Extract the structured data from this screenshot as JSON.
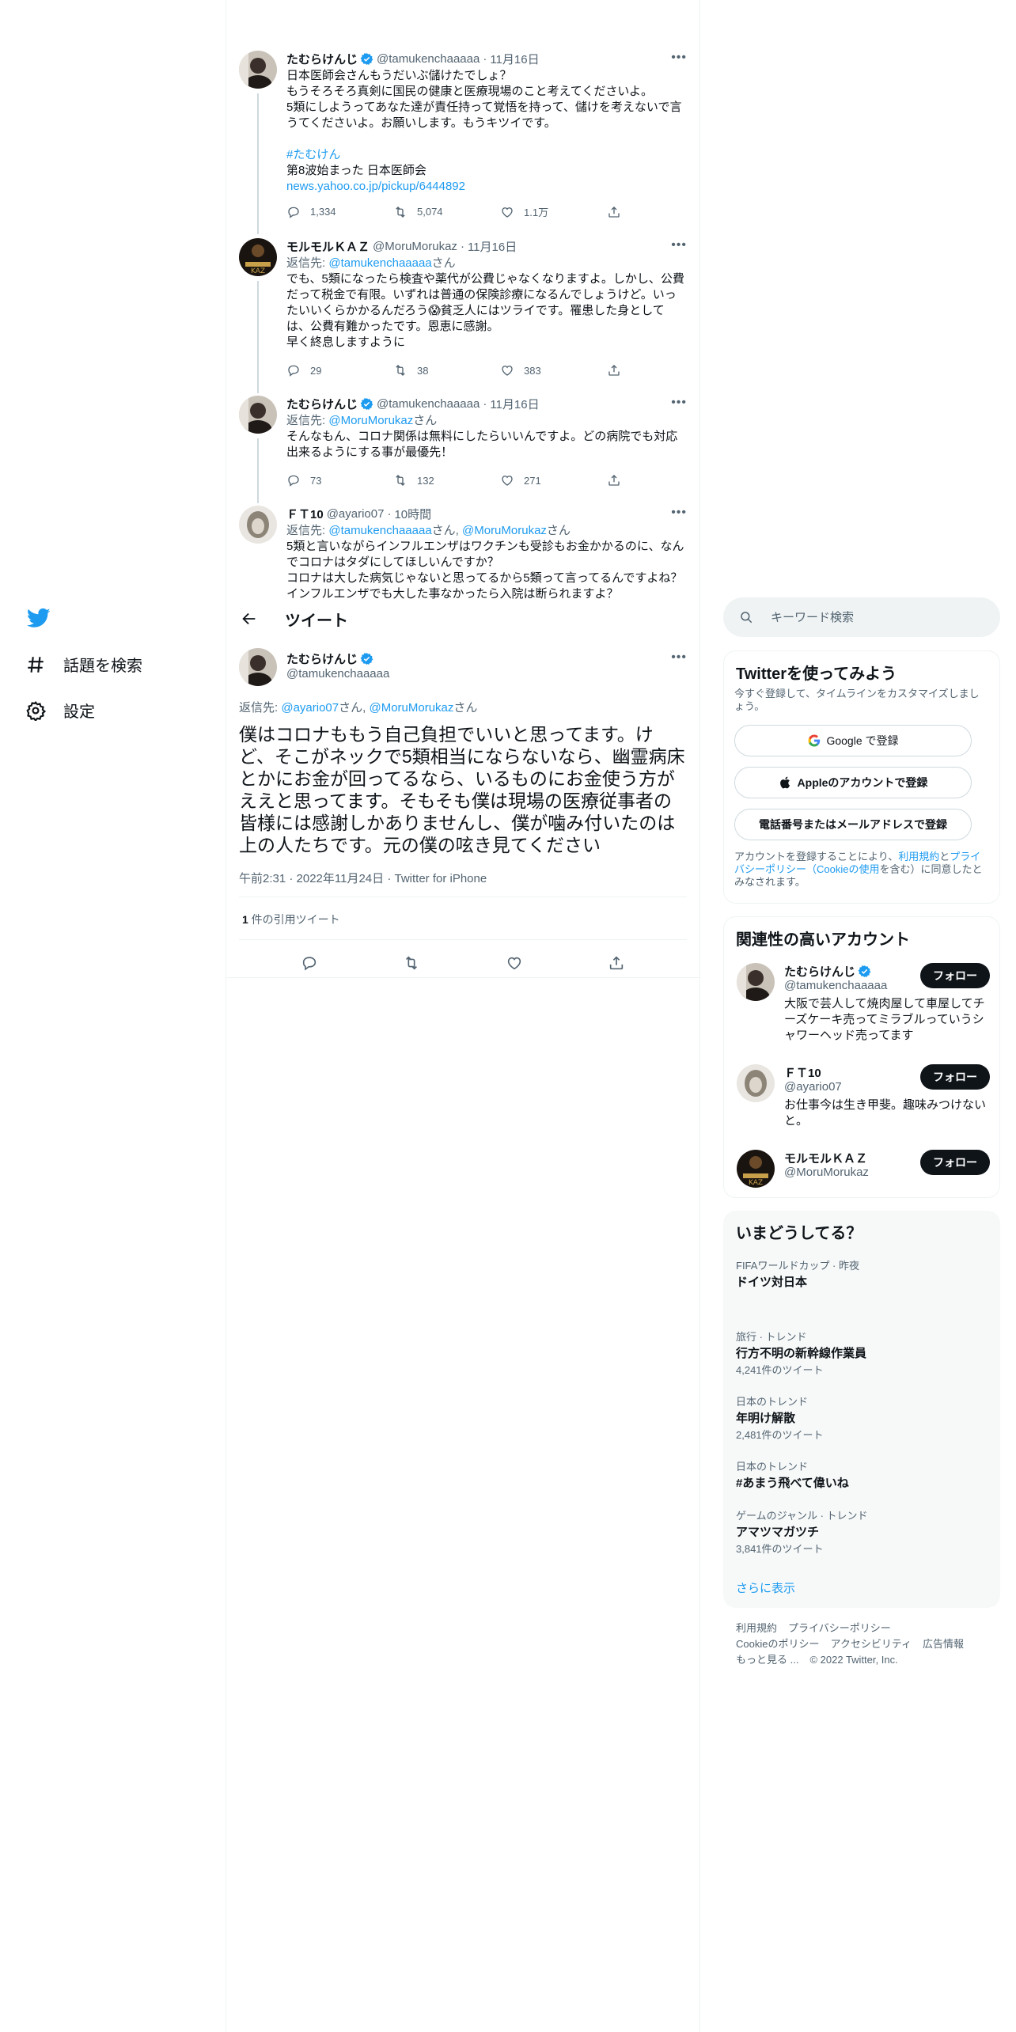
{
  "nav": {
    "items": [
      {
        "label": "話題を検索",
        "icon": "hashtag-icon"
      },
      {
        "label": "設定",
        "icon": "gear-icon"
      }
    ]
  },
  "thread": [
    {
      "name": "たむらけんじ",
      "verified": true,
      "handle": "@tamukenchaaaaa",
      "date": "11月16日",
      "lines": [
        "日本医師会さんもうだいぶ儲けたでしょ？",
        "もうそろそろ真剣に国民の健康と医療現場のこと考えてくださいよ。",
        "5類にしようってあなた達が責任持って覚悟を持って、儲けを考えないで言うてくださいよ。お願いします。もうキツイです。"
      ],
      "hashtag": "#たむけん",
      "card_title": "第8波始まった 日本医師会",
      "link": "news.yahoo.co.jp/pickup/6444892",
      "replies": "1,334",
      "retweets": "5,074",
      "likes": "1.1万"
    },
    {
      "name": "モルモルＫＡＺ",
      "handle": "@MoruMorukaz",
      "date": "11月16日",
      "reply_prefix": "返信先: ",
      "reply_to": "@tamukenchaaaaa",
      "reply_suffix": "さん",
      "lines": [
        "でも、5類になったら検査や薬代が公費じゃなくなりますよ。しかし、公費だって税金で有限。いずれは普通の保険診療になるんでしょうけど。いったいいくらかかるんだろう😱貧乏人にはツライです。罹患した身としては、公費有難かったです。恩恵に感謝。",
        "早く終息しますように"
      ],
      "replies": "29",
      "retweets": "38",
      "likes": "383"
    },
    {
      "name": "たむらけんじ",
      "verified": true,
      "handle": "@tamukenchaaaaa",
      "date": "11月16日",
      "reply_prefix": "返信先: ",
      "reply_to": "@MoruMorukaz",
      "reply_suffix": "さん",
      "lines": [
        "そんなもん、コロナ関係は無料にしたらいいんですよ。どの病院でも対応出来るようにする事が最優先！"
      ],
      "replies": "73",
      "retweets": "132",
      "likes": "271"
    },
    {
      "name": "ＦＴ10",
      "handle": "@ayario07",
      "date": "10時間",
      "reply_prefix": "返信先: ",
      "reply_to": "@tamukenchaaaaa",
      "reply_mid": "さん, ",
      "reply_to2": "@MoruMorukaz",
      "reply_suffix": "さん",
      "lines": [
        "5類と言いながらインフルエンザはワクチンも受診もお金かかるのに、なんでコロナはタダにしてほしいんですか？",
        "コロナは大した病気じゃないと思ってるから5類って言ってるんですよね？",
        "インフルエンザでも大した事なかったら入院は断られますよ？"
      ]
    }
  ],
  "detail": {
    "header_title": "ツイート",
    "name": "たむらけんじ",
    "verified": true,
    "handle": "@tamukenchaaaaa",
    "reply_prefix": "返信先: ",
    "reply_to": "@ayario07",
    "reply_mid": "さん, ",
    "reply_to2": "@MoruMorukaz",
    "reply_suffix": "さん",
    "text": "僕はコロナももう自己負担でいいと思ってます。けど、そこがネックで5類相当にならないなら、幽霊病床とかにお金が回ってるなら、いるものにお金使う方がええと思ってます。そもそも僕は現場の医療従事者の皆様には感謝しかありませんし、僕が噛み付いたのは上の人たちです。元の僕の呟き見てください",
    "meta": "午前2:31 · 2022年11月24日 · Twitter for iPhone",
    "quote_count": "1",
    "quote_label": " 件の引用ツイート"
  },
  "search": {
    "placeholder": "キーワード検索"
  },
  "signup": {
    "title": "Twitterを使ってみよう",
    "subtitle": "今すぐ登録して、タイムラインをカスタマイズしましょう。",
    "google": "Google で登録",
    "apple": "Appleのアカウントで登録",
    "phone": "電話番号またはメールアドレスで登録",
    "terms_prefix": "アカウントを登録することにより、",
    "terms_link1": "利用規約",
    "terms_and": "と",
    "terms_link2": "プライバシーポリシー（Cookieの使用",
    "terms_suffix": "を含む）に同意したとみなされます。"
  },
  "related": {
    "title": "関連性の高いアカウント",
    "follow_label": "フォロー",
    "accounts": [
      {
        "name": "たむらけんじ",
        "verified": true,
        "handle": "@tamukenchaaaaa",
        "bio": "大阪で芸人して焼肉屋して車屋してチーズケーキ売ってミラブルっていうシャワーヘッド売ってます"
      },
      {
        "name": "ＦＴ10",
        "handle": "@ayario07",
        "bio": "お仕事今は生き甲斐。趣味みつけない と。"
      },
      {
        "name": "モルモルＫＡＺ",
        "handle": "@MoruMorukaz",
        "bio": ""
      }
    ]
  },
  "trends": {
    "title": "いまどうしてる？",
    "items": [
      {
        "category": "FIFAワールドカップ · 昨夜",
        "name": "ドイツ対日本",
        "count": ""
      },
      {
        "category": "旅行 · トレンド",
        "name": "行方不明の新幹線作業員",
        "count": "4,241件のツイート"
      },
      {
        "category": "日本のトレンド",
        "name": "年明け解散",
        "count": "2,481件のツイート"
      },
      {
        "category": "日本のトレンド",
        "name": "#あまう飛べて偉いね",
        "count": ""
      },
      {
        "category": "ゲームのジャンル · トレンド",
        "name": "アマツマガツチ",
        "count": "3,841件のツイート"
      }
    ],
    "show_more": "さらに表示"
  },
  "footer": {
    "terms": "利用規約",
    "privacy": "プライバシーポリシー",
    "cookie": "Cookieのポリシー",
    "accessibility": "アクセシビリティ",
    "ads": "広告情報",
    "more": "もっと見る ...",
    "copyright": "© 2022 Twitter, Inc."
  },
  "colors": {
    "accent": "#1d9bf0",
    "text": "#0f1419",
    "muted": "#536471",
    "border": "#eff3f4"
  }
}
